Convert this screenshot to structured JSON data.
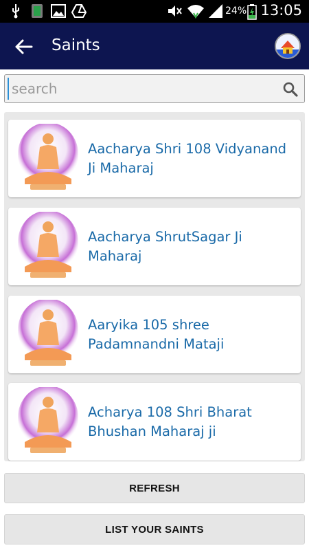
{
  "status_bar": {
    "battery_percent": "24%",
    "time": "13:05",
    "icons": [
      "usb-icon",
      "sd-card-icon",
      "image-icon",
      "drive-icon",
      "mute-icon",
      "wifi-icon",
      "signal-icon",
      "battery-charging-icon"
    ]
  },
  "app_bar": {
    "title": "Saints",
    "back_icon": "arrow-back-icon",
    "home_icon": "home-icon",
    "background_color": "#0d1550"
  },
  "search": {
    "placeholder": "search",
    "value": ""
  },
  "saints": [
    {
      "name": "Aacharya Shri 108 Vidyanand Ji Maharaj"
    },
    {
      "name": "Aacharya ShrutSagar Ji Maharaj"
    },
    {
      "name": "Aaryika 105 shree Padamnandni Mataji"
    },
    {
      "name": "Acharya 108 Shri Bharat Bhushan Maharaj ji"
    }
  ],
  "buttons": {
    "refresh": "REFRESH",
    "list_saints": "LIST YOUR SAINTS"
  },
  "colors": {
    "accent": "#1a6aa8",
    "app_bar": "#0d1550"
  }
}
